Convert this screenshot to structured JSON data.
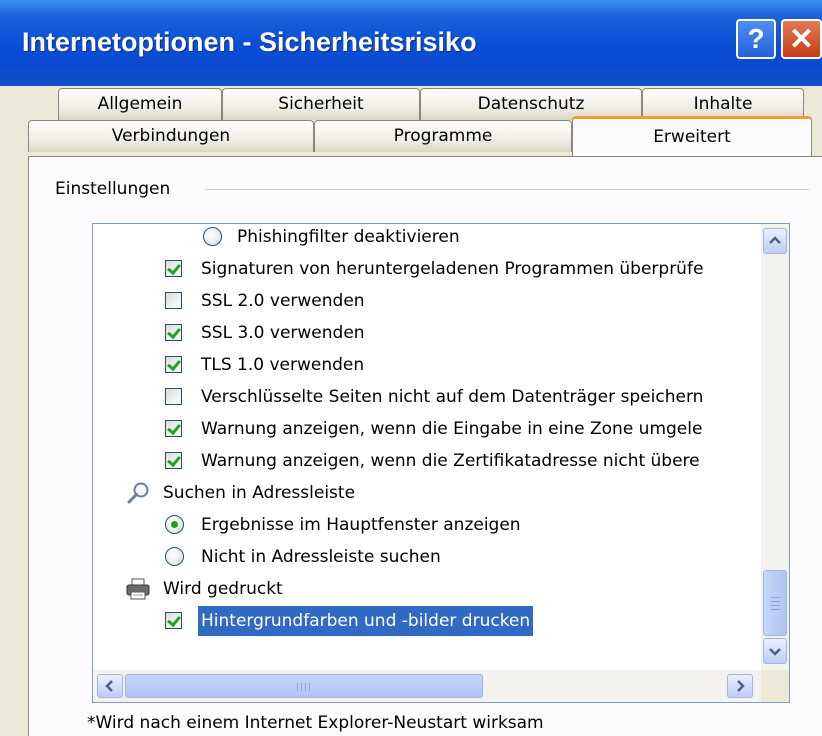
{
  "window": {
    "title": "Internetoptionen - Sicherheitsrisiko",
    "help_label": "?",
    "close_label": "✕"
  },
  "tabs": {
    "row1": [
      "Allgemein",
      "Sicherheit",
      "Datenschutz",
      "Inhalte"
    ],
    "row2": [
      "Verbindungen",
      "Programme",
      "Erweitert"
    ],
    "active": "Erweitert"
  },
  "panel": {
    "group_label": "Einstellungen",
    "footnote": "*Wird nach einem Internet Explorer-Neustart wirksam"
  },
  "settings": {
    "items": [
      {
        "type": "radio",
        "checked": false,
        "label": "Phishingfilter deaktivieren"
      },
      {
        "type": "checkbox",
        "checked": true,
        "label": "Signaturen von heruntergeladenen Programmen überprüfe"
      },
      {
        "type": "checkbox",
        "checked": false,
        "label": "SSL 2.0 verwenden"
      },
      {
        "type": "checkbox",
        "checked": true,
        "label": "SSL 3.0 verwenden"
      },
      {
        "type": "checkbox",
        "checked": true,
        "label": "TLS 1.0 verwenden"
      },
      {
        "type": "checkbox",
        "checked": false,
        "label": "Verschlüsselte Seiten nicht auf dem Datenträger speichern"
      },
      {
        "type": "checkbox",
        "checked": true,
        "label": "Warnung anzeigen, wenn die Eingabe in eine Zone umgele"
      },
      {
        "type": "checkbox",
        "checked": true,
        "label": "Warnung anzeigen, wenn die Zertifikatadresse nicht übere"
      },
      {
        "type": "category",
        "icon": "magnifier-icon",
        "label": "Suchen in Adressleiste"
      },
      {
        "type": "radio",
        "checked": true,
        "label": "Ergebnisse im Hauptfenster anzeigen"
      },
      {
        "type": "radio",
        "checked": false,
        "label": "Nicht in Adressleiste suchen"
      },
      {
        "type": "category",
        "icon": "printer-icon",
        "label": "Wird gedruckt"
      },
      {
        "type": "checkbox",
        "checked": true,
        "selected": true,
        "label": "Hintergrundfarben und -bilder drucken"
      }
    ]
  },
  "colors": {
    "titlebar": "#0a4fd6",
    "selection": "#316ac5",
    "active_tab_accent": "#f0a030",
    "check": "#21a121"
  }
}
